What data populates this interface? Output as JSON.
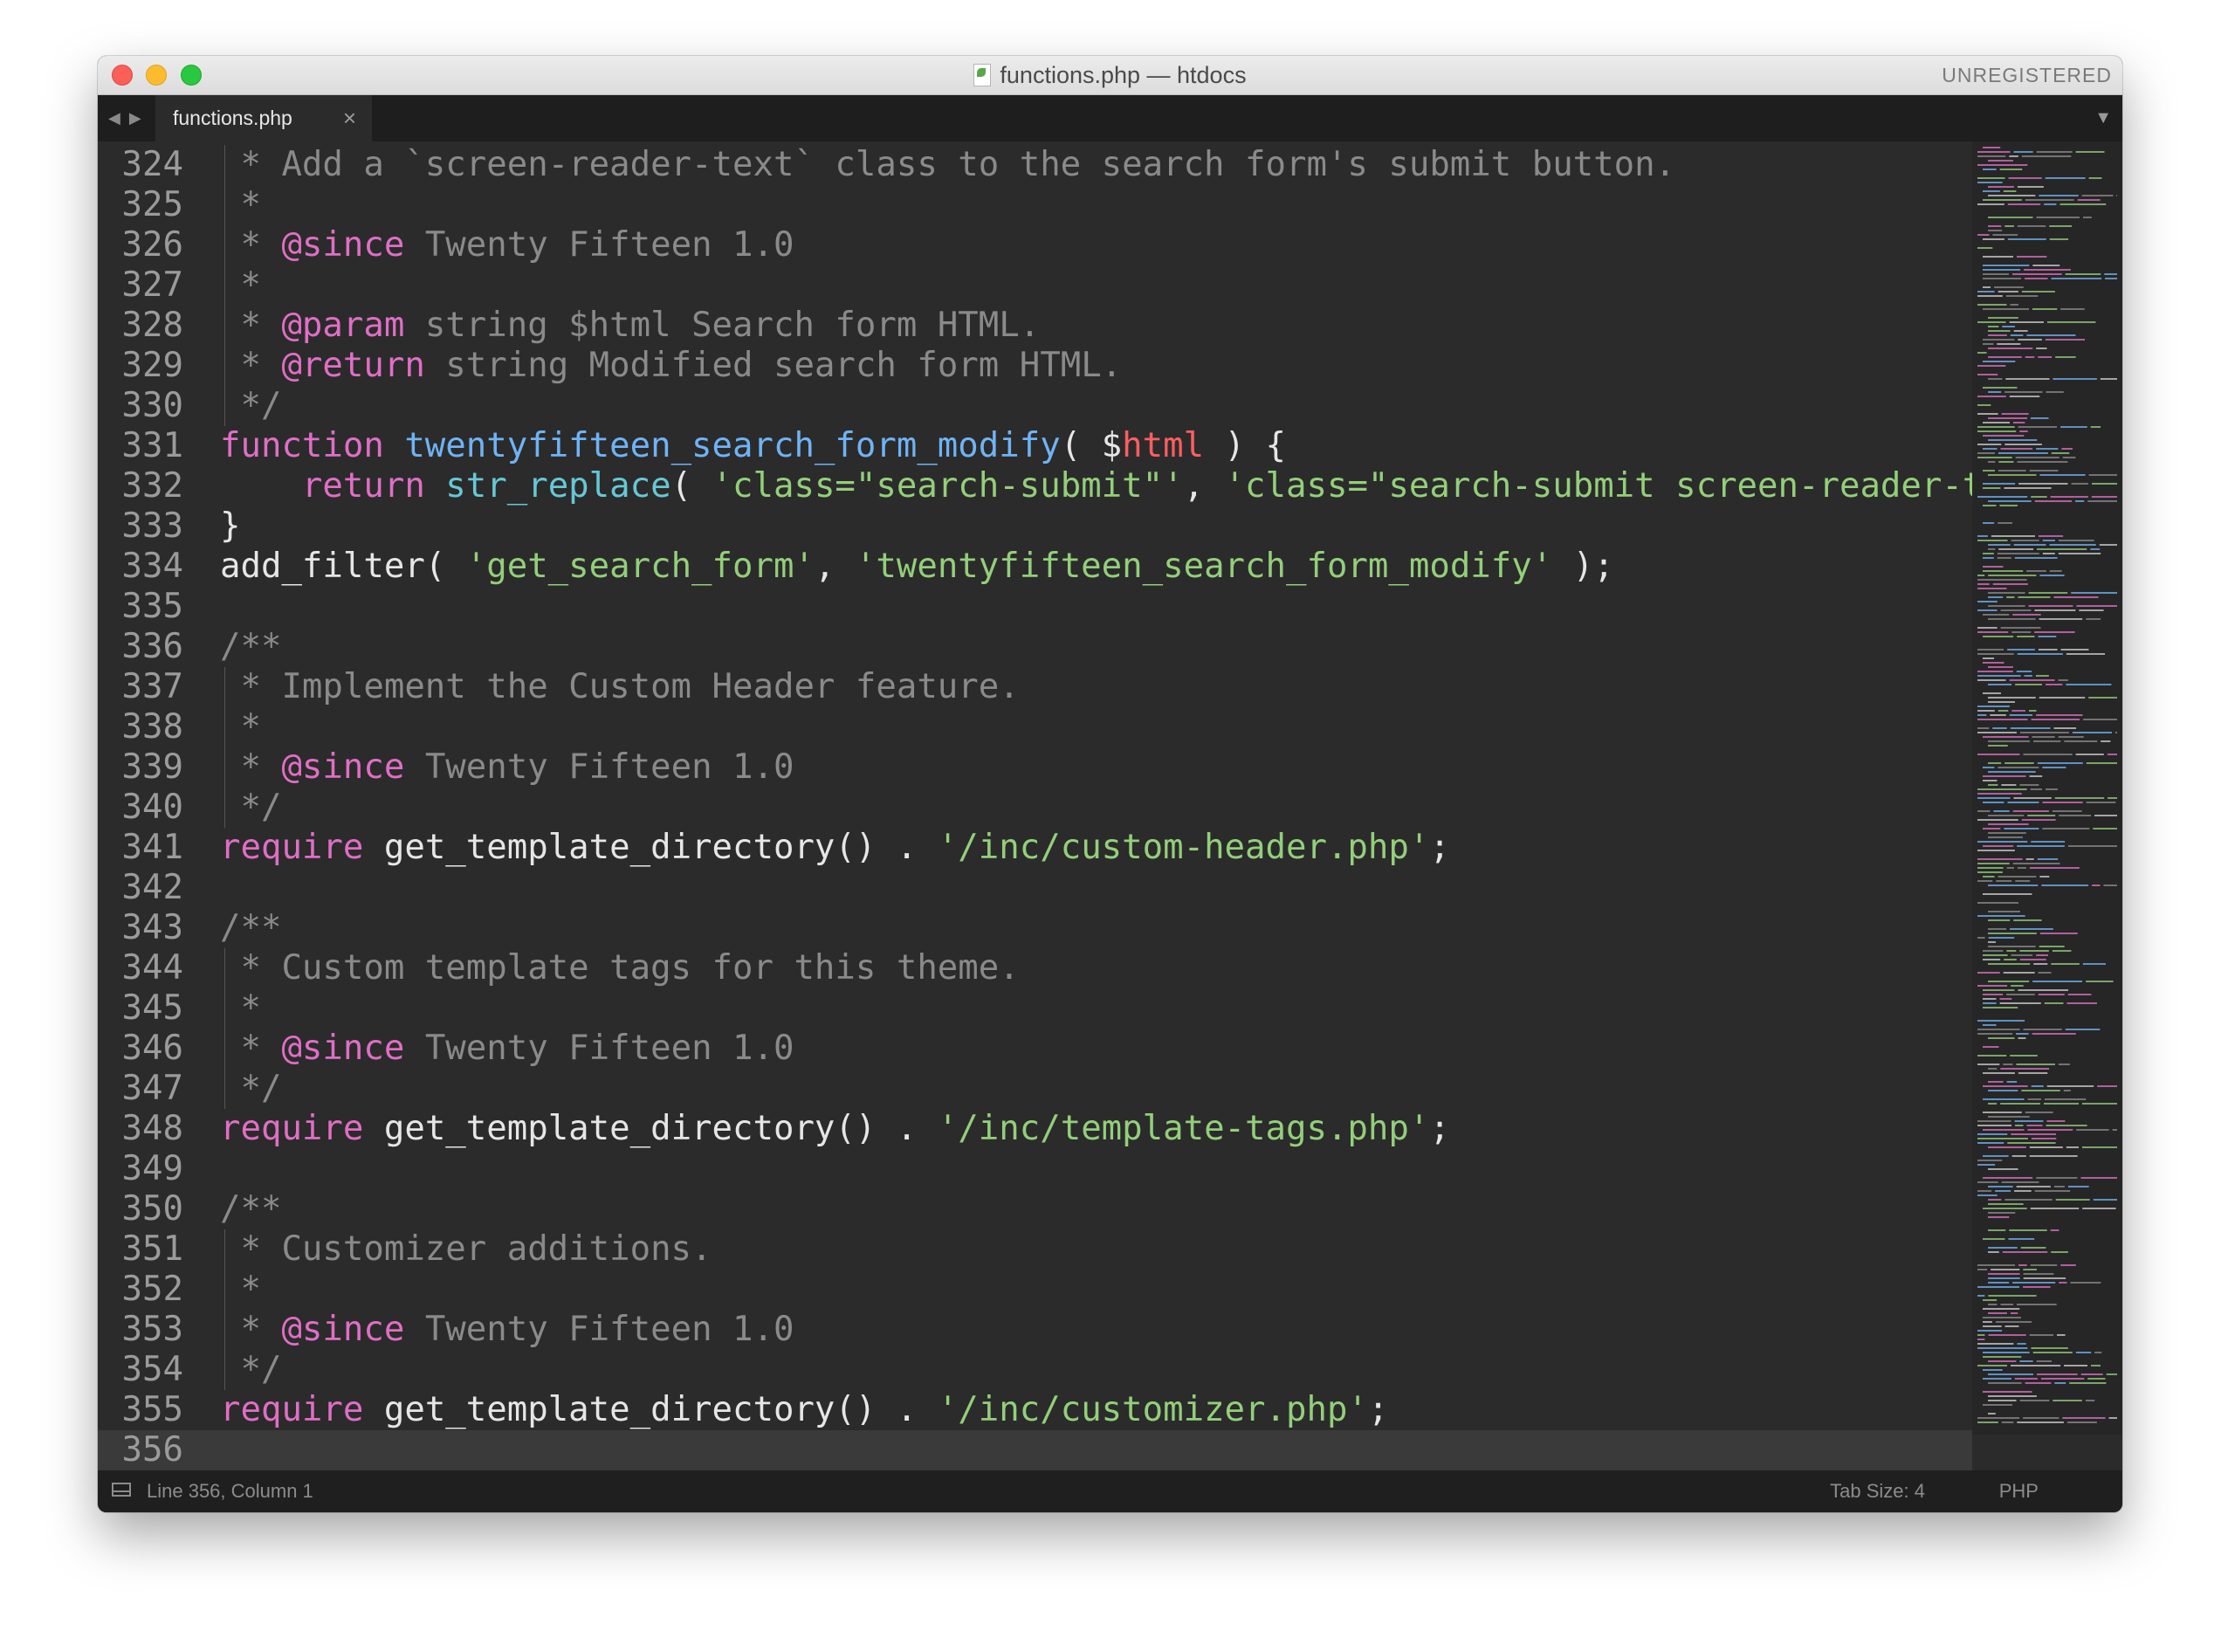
{
  "window": {
    "title": "functions.php — htdocs",
    "license_label": "UNREGISTERED"
  },
  "tabs": [
    {
      "label": "functions.php",
      "active": true
    }
  ],
  "editor": {
    "language": "PHP",
    "lines": [
      {
        "num": "324",
        "segments": [
          {
            "t": " * Add a `screen-reader-text` class to the search form's submit button.",
            "c": "cm"
          }
        ]
      },
      {
        "num": "325",
        "segments": [
          {
            "t": " *",
            "c": "cm"
          }
        ]
      },
      {
        "num": "326",
        "segments": [
          {
            "t": " * ",
            "c": "cm"
          },
          {
            "t": "@since",
            "c": "tag"
          },
          {
            "t": " Twenty Fifteen 1.0",
            "c": "cm"
          }
        ]
      },
      {
        "num": "327",
        "segments": [
          {
            "t": " *",
            "c": "cm"
          }
        ]
      },
      {
        "num": "328",
        "segments": [
          {
            "t": " * ",
            "c": "cm"
          },
          {
            "t": "@param",
            "c": "tag"
          },
          {
            "t": " string $html Search form HTML.",
            "c": "cm"
          }
        ]
      },
      {
        "num": "329",
        "segments": [
          {
            "t": " * ",
            "c": "cm"
          },
          {
            "t": "@return",
            "c": "tag"
          },
          {
            "t": " string Modified search form HTML.",
            "c": "cm"
          }
        ]
      },
      {
        "num": "330",
        "segments": [
          {
            "t": " */",
            "c": "cm"
          }
        ]
      },
      {
        "num": "331",
        "segments": [
          {
            "t": "function",
            "c": "kw"
          },
          {
            "t": " ",
            "c": ""
          },
          {
            "t": "twentyfifteen_search_form_modify",
            "c": "fn"
          },
          {
            "t": "( $",
            "c": ""
          },
          {
            "t": "html",
            "c": "vr"
          },
          {
            "t": " ) {",
            "c": ""
          }
        ]
      },
      {
        "num": "332",
        "segments": [
          {
            "t": "    ",
            "c": ""
          },
          {
            "t": "return",
            "c": "kw"
          },
          {
            "t": " ",
            "c": ""
          },
          {
            "t": "str_replace",
            "c": "bi"
          },
          {
            "t": "( ",
            "c": ""
          },
          {
            "t": "'class=\"search-submit\"'",
            "c": "st"
          },
          {
            "t": ", ",
            "c": ""
          },
          {
            "t": "'class=\"search-submit screen-reader-tex",
            "c": "st"
          }
        ]
      },
      {
        "num": "333",
        "segments": [
          {
            "t": "}",
            "c": ""
          }
        ]
      },
      {
        "num": "334",
        "segments": [
          {
            "t": "add_filter( ",
            "c": ""
          },
          {
            "t": "'get_search_form'",
            "c": "st"
          },
          {
            "t": ", ",
            "c": ""
          },
          {
            "t": "'twentyfifteen_search_form_modify'",
            "c": "st"
          },
          {
            "t": " );",
            "c": ""
          }
        ]
      },
      {
        "num": "335",
        "segments": []
      },
      {
        "num": "336",
        "segments": [
          {
            "t": "/**",
            "c": "cm"
          }
        ]
      },
      {
        "num": "337",
        "segments": [
          {
            "t": " * Implement the Custom Header feature.",
            "c": "cm"
          }
        ]
      },
      {
        "num": "338",
        "segments": [
          {
            "t": " *",
            "c": "cm"
          }
        ]
      },
      {
        "num": "339",
        "segments": [
          {
            "t": " * ",
            "c": "cm"
          },
          {
            "t": "@since",
            "c": "tag"
          },
          {
            "t": " Twenty Fifteen 1.0",
            "c": "cm"
          }
        ]
      },
      {
        "num": "340",
        "segments": [
          {
            "t": " */",
            "c": "cm"
          }
        ]
      },
      {
        "num": "341",
        "segments": [
          {
            "t": "require",
            "c": "kw"
          },
          {
            "t": " get_template_directory() . ",
            "c": ""
          },
          {
            "t": "'/inc/custom-header.php'",
            "c": "st"
          },
          {
            "t": ";",
            "c": ""
          }
        ]
      },
      {
        "num": "342",
        "segments": []
      },
      {
        "num": "343",
        "segments": [
          {
            "t": "/**",
            "c": "cm"
          }
        ]
      },
      {
        "num": "344",
        "segments": [
          {
            "t": " * Custom template tags for this theme.",
            "c": "cm"
          }
        ]
      },
      {
        "num": "345",
        "segments": [
          {
            "t": " *",
            "c": "cm"
          }
        ]
      },
      {
        "num": "346",
        "segments": [
          {
            "t": " * ",
            "c": "cm"
          },
          {
            "t": "@since",
            "c": "tag"
          },
          {
            "t": " Twenty Fifteen 1.0",
            "c": "cm"
          }
        ]
      },
      {
        "num": "347",
        "segments": [
          {
            "t": " */",
            "c": "cm"
          }
        ]
      },
      {
        "num": "348",
        "segments": [
          {
            "t": "require",
            "c": "kw"
          },
          {
            "t": " get_template_directory() . ",
            "c": ""
          },
          {
            "t": "'/inc/template-tags.php'",
            "c": "st"
          },
          {
            "t": ";",
            "c": ""
          }
        ]
      },
      {
        "num": "349",
        "segments": []
      },
      {
        "num": "350",
        "segments": [
          {
            "t": "/**",
            "c": "cm"
          }
        ]
      },
      {
        "num": "351",
        "segments": [
          {
            "t": " * Customizer additions.",
            "c": "cm"
          }
        ]
      },
      {
        "num": "352",
        "segments": [
          {
            "t": " *",
            "c": "cm"
          }
        ]
      },
      {
        "num": "353",
        "segments": [
          {
            "t": " * ",
            "c": "cm"
          },
          {
            "t": "@since",
            "c": "tag"
          },
          {
            "t": " Twenty Fifteen 1.0",
            "c": "cm"
          }
        ]
      },
      {
        "num": "354",
        "segments": [
          {
            "t": " */",
            "c": "cm"
          }
        ]
      },
      {
        "num": "355",
        "segments": [
          {
            "t": "require",
            "c": "kw"
          },
          {
            "t": " get_template_directory() . ",
            "c": ""
          },
          {
            "t": "'/inc/customizer.php'",
            "c": "st"
          },
          {
            "t": ";",
            "c": ""
          }
        ]
      },
      {
        "num": "356",
        "segments": [],
        "current": true
      }
    ]
  },
  "statusbar": {
    "position": "Line 356, Column 1",
    "tab_size": "Tab Size: 4",
    "syntax": "PHP"
  },
  "icons": {
    "close": "close-icon",
    "minimize": "minimize-icon",
    "maximize": "maximize-icon",
    "file": "php-file-icon",
    "nav_back": "back-arrow-icon",
    "nav_forward": "forward-arrow-icon",
    "tab_close": "tab-close-icon",
    "tab_menu": "dropdown-triangle-icon",
    "panel": "panel-toggle-icon"
  },
  "colors": {
    "comment": "#8a8a8a",
    "keyword": "#e06ec6",
    "function": "#6fb3f5",
    "builtin": "#66c8d6",
    "string": "#93cf7a",
    "variable": "#ff5e62",
    "background": "#2b2b2b"
  }
}
